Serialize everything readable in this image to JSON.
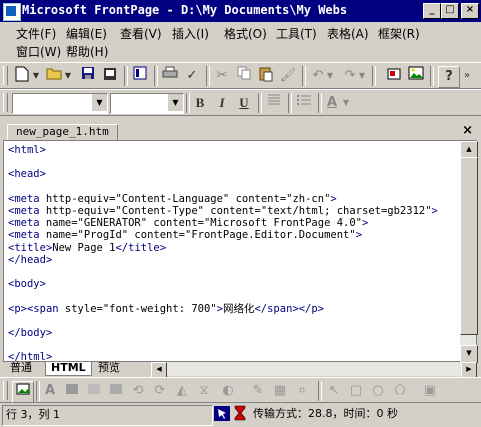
{
  "window": {
    "title": "Microsoft FrontPage - D:\\My Documents\\My Webs",
    "min_symbol": "_",
    "max_symbol": "□",
    "close_symbol": "×"
  },
  "menu": {
    "items": [
      "文件(F)",
      "编辑(E)",
      "查看(V)",
      "插入(I)",
      "格式(O)",
      "工具(T)",
      "表格(A)",
      "框架(R)",
      "窗口(W)",
      "帮助(H)"
    ]
  },
  "toolbar_standard": {
    "icons": [
      "new-page-icon",
      "open-icon",
      "save-icon",
      "publish-icon",
      "folder-list-icon",
      "print-icon",
      "spelling-icon",
      "cut-icon",
      "copy-icon",
      "paste-icon",
      "format-painter-icon",
      "undo-icon",
      "redo-icon",
      "insert-component-icon",
      "insert-picture-icon",
      "help-icon"
    ]
  },
  "toolbar_format": {
    "style_value": "",
    "font_value": "",
    "bold": "B",
    "italic": "I",
    "underline": "U",
    "font_color_letter": "A"
  },
  "document": {
    "tab_label": "new_page_1.htm",
    "close": "×",
    "code_lines": [
      "<html>",
      "",
      "<head>",
      "",
      "<meta http-equiv=\"Content-Language\" content=\"zh-cn\">",
      "<meta http-equiv=\"Content-Type\" content=\"text/html; charset=gb2312\">",
      "<meta name=\"GENERATOR\" content=\"Microsoft FrontPage 4.0\">",
      "<meta name=\"ProgId\" content=\"FrontPage.Editor.Document\">",
      "<title>New Page 1</title>",
      "</head>",
      "",
      "<body>",
      "",
      "<p><span style=\"font-weight: 700\">网络化</span></p>",
      "",
      "</body>",
      "",
      "</html>"
    ]
  },
  "view_tabs": [
    "普通",
    "HTML",
    "预览"
  ],
  "view_tabs_active": "HTML",
  "status": {
    "position": "行 3，列 1",
    "transfer": "传输方式：28.8，时间：0 秒"
  }
}
